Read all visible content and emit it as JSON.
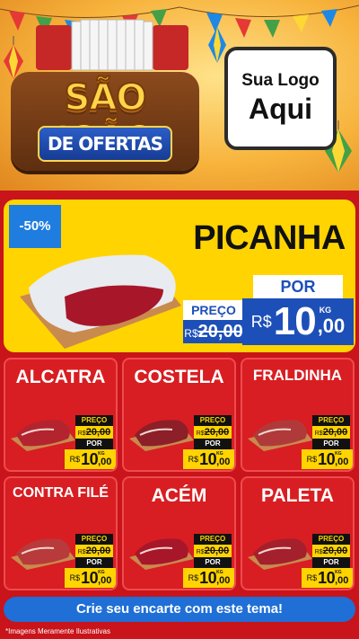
{
  "header": {
    "title_line1": "SÃO JOÃO",
    "title_line2": "DE OFERTAS",
    "logo_line1": "Sua Logo",
    "logo_line2": "Aqui"
  },
  "hero": {
    "discount_badge": "-50%",
    "name": "PICANHA",
    "old_label": "PREÇO",
    "old_currency": "R$",
    "old_price": "20,00",
    "new_label": "POR",
    "currency": "R$",
    "price_int": "10",
    "price_dec": ",00",
    "unit": "KG"
  },
  "price_defaults": {
    "old_label": "PREÇO",
    "old_currency": "R$",
    "old_price": "20,00",
    "new_label": "POR",
    "currency": "R$",
    "price_int": "10",
    "price_dec": ",00",
    "unit": "KG"
  },
  "products": [
    {
      "name": "ALCATRA"
    },
    {
      "name": "COSTELA"
    },
    {
      "name": "FRALDINHA"
    },
    {
      "name": "CONTRA FILÉ"
    },
    {
      "name": "ACÉM"
    },
    {
      "name": "PALETA"
    }
  ],
  "footer": {
    "cta_label": "Crie seu encarte com este tema!",
    "disclaimer": "*Imagens Meramente Ilustrativas"
  },
  "colors": {
    "background_red": "#c8141a",
    "card_red": "#d81e22",
    "hero_yellow": "#ffd400",
    "price_blue": "#1d4fb8",
    "cta_blue": "#1f6fd6",
    "badge_blue": "#1f7de0"
  }
}
